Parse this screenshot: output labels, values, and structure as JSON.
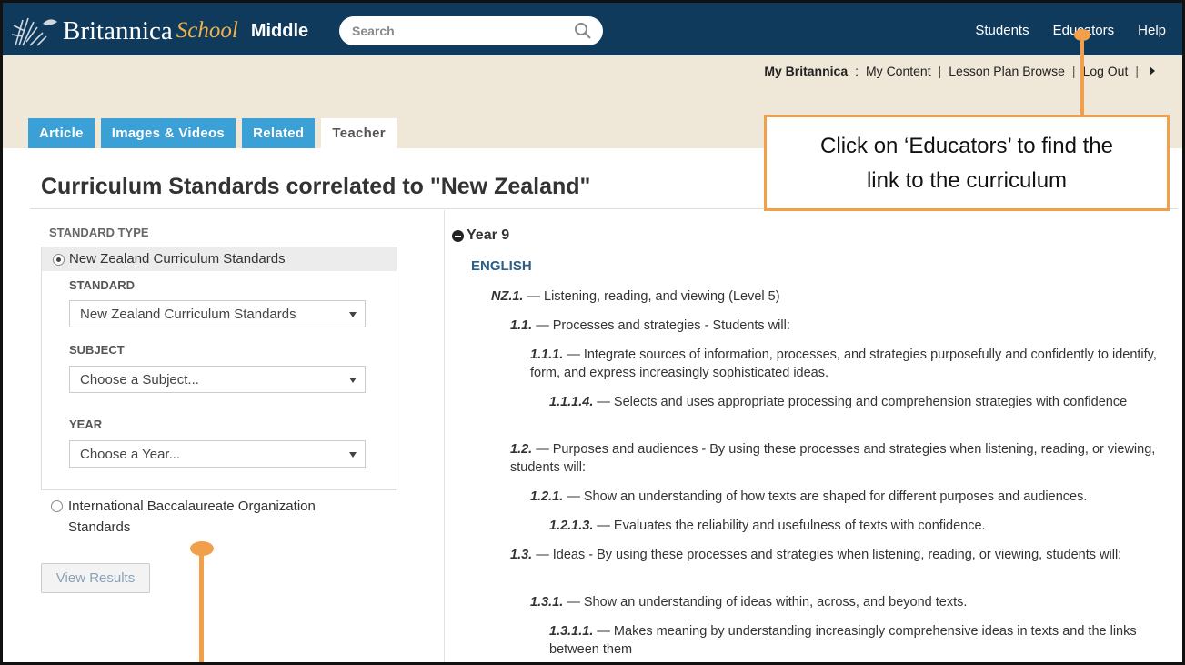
{
  "header": {
    "brand": "Britannica",
    "brand_school": "School",
    "brand_level": "Middle",
    "search_placeholder": "Search",
    "nav": [
      "Students",
      "Educators",
      "Help"
    ]
  },
  "subnav": {
    "my_britannica": "My Britannica",
    "colon": ":",
    "links": [
      "My Content",
      "Lesson Plan Browse",
      "Log Out"
    ],
    "separator": "|"
  },
  "tabs": [
    {
      "label": "Article",
      "active": false
    },
    {
      "label": "Images & Videos",
      "active": false
    },
    {
      "label": "Related",
      "active": false
    },
    {
      "label": "Teacher",
      "active": true
    }
  ],
  "page_title": "Curriculum Standards correlated to \"New Zealand\"",
  "filters": {
    "standard_type_label": "STANDARD TYPE",
    "option_nz": "New Zealand Curriculum Standards",
    "standard_label": "STANDARD",
    "standard_value": "New Zealand Curriculum Standards",
    "subject_label": "SUBJECT",
    "subject_value": "Choose a Subject...",
    "year_label": "YEAR",
    "year_value": "Choose a Year...",
    "option_ib_line1": "International Baccalaureate Organization",
    "option_ib_line2": "Standards",
    "view_results": "View Results"
  },
  "results": {
    "year": "Year 9",
    "subject": "ENGLISH",
    "standards": [
      {
        "code": "NZ.1.",
        "text": "— Listening, reading, and viewing (Level 5)"
      },
      {
        "code": "1.1.",
        "text": "— Processes and strategies - Students will:"
      },
      {
        "code": "1.1.1.",
        "text": "— Integrate sources of information, processes, and strategies purposefully and confidently to identify, form, and express increasingly sophisticated ideas."
      },
      {
        "code": "1.1.1.4.",
        "text": "— Selects and uses appropriate processing and comprehension strategies with confidence"
      },
      {
        "code": "1.2.",
        "text": "— Purposes and audiences - By using these processes and strategies when listening, reading, or viewing, students will:"
      },
      {
        "code": "1.2.1.",
        "text": "— Show an understanding of how texts are shaped for different purposes and audiences."
      },
      {
        "code": "1.2.1.3.",
        "text": "— Evaluates the reliability and usefulness of texts with confidence."
      },
      {
        "code": "1.3.",
        "text": "— Ideas - By using these processes and strategies when listening, reading, or viewing, students will:"
      },
      {
        "code": "1.3.1.",
        "text": "— Show an understanding of ideas within, across, and beyond texts."
      },
      {
        "code": "1.3.1.1.",
        "text": "— Makes meaning by understanding increasingly comprehensive ideas in texts and the links between them"
      }
    ]
  },
  "annotation": {
    "line1": "Click on ‘Educators’ to find the",
    "line2": "link to the curriculum"
  },
  "colors": {
    "header_bg": "#0f3a5c",
    "tab_blue": "#3aa0d6",
    "annotation_orange": "#f29f4b",
    "band_bg": "#efe7d7"
  }
}
